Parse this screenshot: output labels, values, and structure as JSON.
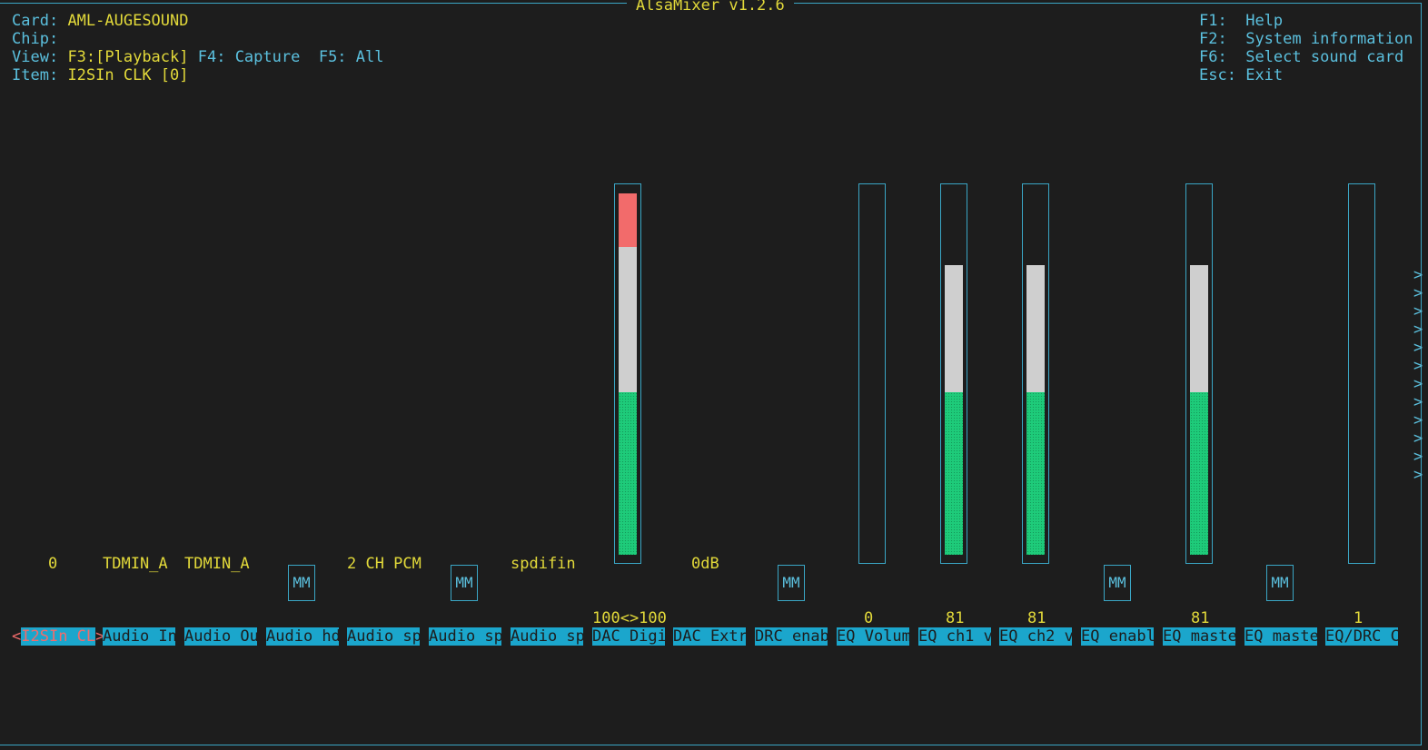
{
  "title": "AlsaMixer v1.2.6",
  "header": {
    "card_label": "Card:",
    "card_value": "AML-AUGESOUND",
    "chip_label": "Chip:",
    "chip_value": "",
    "view_label": "View:",
    "view_playback": "F3:[Playback]",
    "view_capture": "F4: Capture",
    "view_all": "F5: All",
    "item_label": "Item:",
    "item_value": "I2SIn CLK [0]"
  },
  "help": [
    {
      "key": "F1:",
      "label": "Help"
    },
    {
      "key": "F2:",
      "label": "System information"
    },
    {
      "key": "F6:",
      "label": "Select sound card"
    },
    {
      "key": "Esc:",
      "label": "Exit"
    }
  ],
  "enum_values": {
    "i2sin_clk": "0",
    "audio_in": "TDMIN_A",
    "audio_out": "TDMIN_A",
    "audio_sp1": "2 CH PCM",
    "audio_sp3": "spdifin",
    "dac_extr": "0dB"
  },
  "mute_label": "MM",
  "percent": {
    "dac_digi": "100<>100",
    "eq_volume": "0",
    "eq_ch1": "81",
    "eq_ch2": "81",
    "eq_master": "81",
    "eq_drc": "1"
  },
  "levels": {
    "dac_digi": 1.0,
    "eq_volume": 0.0,
    "eq_ch1": 0.81,
    "eq_ch2": 0.81,
    "eq_master": 0.81,
    "eq_drc": 0.01
  },
  "controls": [
    "I2SIn CL",
    "Audio In",
    "Audio Ou",
    "Audio hd",
    "Audio sp",
    "Audio sp",
    "Audio sp",
    "DAC Digi",
    "DAC Extr",
    "DRC enab",
    "EQ Volum",
    "EQ ch1 v",
    "EQ ch2 v",
    "EQ enabl",
    "EQ maste",
    "EQ maste",
    "EQ/DRC C"
  ],
  "more_indicator": ">",
  "colors": {
    "background": "#1d1d1d",
    "frame": "#3aa6c5",
    "text_yellow": "#e2d93a",
    "text_cyan": "#5bc0de",
    "bar_red": "#f26b6b",
    "bar_white": "#cfcfcf",
    "bar_green": "#1ecb7a",
    "label_bg": "#1ba6cc"
  }
}
